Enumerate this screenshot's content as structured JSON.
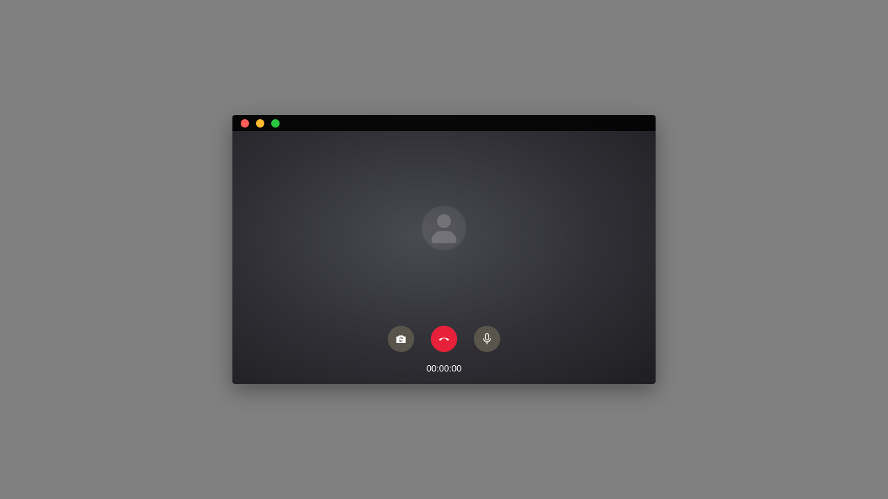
{
  "colors": {
    "close": "#ff5f57",
    "minimize": "#febc2e",
    "maximize": "#28c840",
    "end_call": "#e8213a",
    "control_bg": "#5a554c"
  },
  "controls": {
    "flip_camera_icon": "camera-flip-icon",
    "end_call_icon": "phone-hangup-icon",
    "mute_icon": "microphone-icon"
  },
  "call": {
    "timer": "00:00:00"
  }
}
